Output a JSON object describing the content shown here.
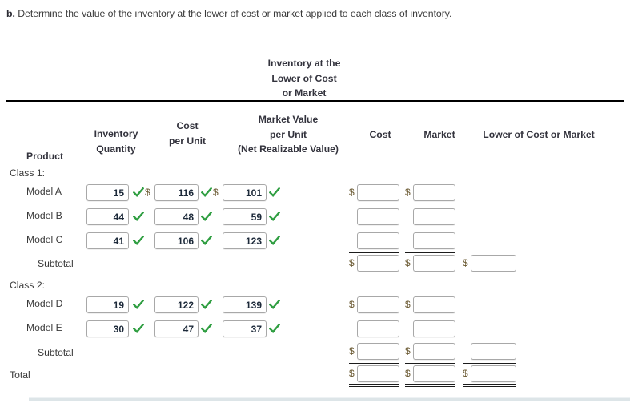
{
  "prompt": {
    "label": "b.",
    "text": "Determine the value of the inventory at the lower of cost or market applied to each class of inventory."
  },
  "group_header": {
    "line1": "Inventory at the",
    "line2": "Lower of Cost",
    "line3": "or Market"
  },
  "columns": {
    "product": "Product",
    "inventory_quantity_l1": "Inventory",
    "inventory_quantity_l2": "Quantity",
    "cost_per_unit_l1": "Cost",
    "cost_per_unit_l2": "per Unit",
    "market_value_l1": "Market Value",
    "market_value_l2": "per Unit",
    "market_value_l3": "(Net Realizable Value)",
    "cost": "Cost",
    "market": "Market",
    "lower_of_cost_or_market": "Lower of Cost or Market"
  },
  "symbols": {
    "dollar": "$",
    "check": "check-icon"
  },
  "sections": [
    {
      "heading": "Class 1:",
      "rows": [
        {
          "label": "Model A",
          "quantity": "15",
          "cost_per_unit": "116",
          "market_value": "101",
          "cost": "",
          "market": "",
          "lcm": ""
        },
        {
          "label": "Model B",
          "quantity": "44",
          "cost_per_unit": "48",
          "market_value": "59",
          "cost": "",
          "market": "",
          "lcm": ""
        },
        {
          "label": "Model C",
          "quantity": "41",
          "cost_per_unit": "106",
          "market_value": "123",
          "cost": "",
          "market": "",
          "lcm": ""
        }
      ],
      "subtotal": {
        "label": "Subtotal",
        "cost": "",
        "market": "",
        "lcm": ""
      }
    },
    {
      "heading": "Class 2:",
      "rows": [
        {
          "label": "Model D",
          "quantity": "19",
          "cost_per_unit": "122",
          "market_value": "139",
          "cost": "",
          "market": "",
          "lcm": ""
        },
        {
          "label": "Model E",
          "quantity": "30",
          "cost_per_unit": "47",
          "market_value": "37",
          "cost": "",
          "market": "",
          "lcm": ""
        }
      ],
      "subtotal": {
        "label": "Subtotal",
        "cost": "",
        "market": "",
        "lcm": ""
      }
    }
  ],
  "total": {
    "label": "Total",
    "cost": "",
    "market": "",
    "lcm": ""
  },
  "colors": {
    "check_green": "#2f9e41",
    "header_text": "#33333d",
    "body_text": "#3a3a3a",
    "rule": "#000000",
    "dollar": "#6b5a33",
    "box_border": "#a8a8a8",
    "bottom_bar": "#dde5e8"
  }
}
